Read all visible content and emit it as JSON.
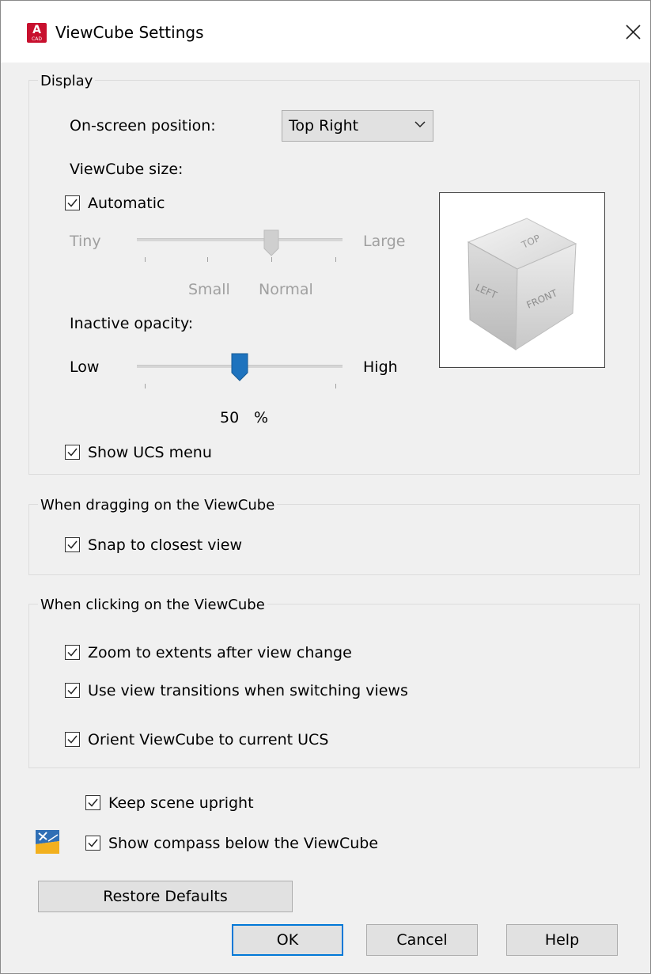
{
  "window": {
    "title": "ViewCube Settings",
    "app_icon_letter": "A",
    "app_icon_sub": "CAD"
  },
  "display": {
    "legend": "Display",
    "position_label": "On-screen position:",
    "position_value": "Top Right",
    "size_label": "ViewCube size:",
    "automatic_label": "Automatic",
    "automatic_checked": true,
    "size_slider": {
      "min_label": "Tiny",
      "max_label": "Large",
      "tick_labels": [
        "Small",
        "Normal"
      ],
      "enabled": false
    },
    "opacity_label": "Inactive opacity:",
    "opacity_slider": {
      "min_label": "Low",
      "max_label": "High",
      "value": 50,
      "unit": "%"
    },
    "show_ucs_menu_label": "Show UCS menu",
    "show_ucs_menu_checked": true,
    "preview_faces": [
      "TOP",
      "LEFT",
      "FRONT"
    ]
  },
  "dragging": {
    "legend": "When dragging on the ViewCube",
    "snap_label": "Snap to closest view",
    "snap_checked": true
  },
  "clicking": {
    "legend": "When clicking on the ViewCube",
    "zoom_label": "Zoom to extents after view change",
    "zoom_checked": true,
    "transitions_label": "Use view transitions when switching views",
    "transitions_checked": true,
    "orient_label": "Orient ViewCube to current UCS",
    "orient_checked": true
  },
  "bottom": {
    "keep_upright_label": "Keep scene upright",
    "keep_upright_checked": true,
    "compass_label": "Show compass below the ViewCube",
    "compass_checked": true,
    "compass_icon": "compass-icon"
  },
  "buttons": {
    "restore": "Restore Defaults",
    "ok": "OK",
    "cancel": "Cancel",
    "help": "Help"
  },
  "colors": {
    "accent": "#0078d7",
    "slider_thumb": "#1e73be",
    "app_icon": "#c8102e"
  }
}
